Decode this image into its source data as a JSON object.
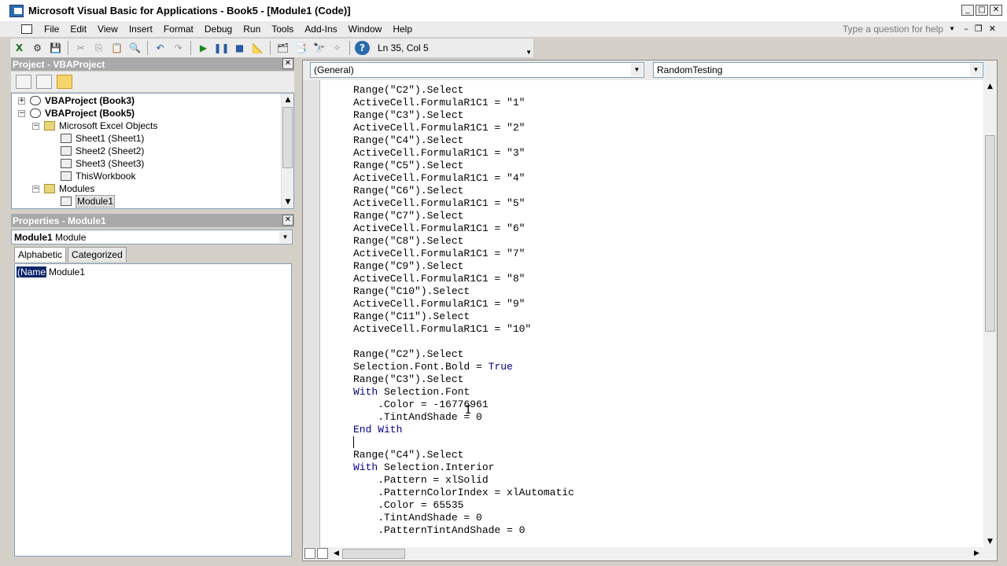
{
  "window": {
    "title": "Microsoft Visual Basic for Applications - Book5 - [Module1 (Code)]"
  },
  "menu": [
    "File",
    "Edit",
    "View",
    "Insert",
    "Format",
    "Debug",
    "Run",
    "Tools",
    "Add-Ins",
    "Window",
    "Help"
  ],
  "help_search": {
    "placeholder": "Type a question for help"
  },
  "toolbar": {
    "status": "Ln 35, Col 5"
  },
  "project_panel": {
    "title": "Project - VBAProject",
    "tree": [
      {
        "label": "VBAProject (Book3)",
        "bold": true,
        "level": 0,
        "expander": "+",
        "icon": "vbaproject-icon"
      },
      {
        "label": "VBAProject (Book5)",
        "bold": true,
        "level": 0,
        "expander": "−",
        "icon": "vbaproject-icon"
      },
      {
        "label": "Microsoft Excel Objects",
        "level": 1,
        "expander": "−",
        "icon": "folder-icon"
      },
      {
        "label": "Sheet1 (Sheet1)",
        "level": 2,
        "icon": "worksheet-icon"
      },
      {
        "label": "Sheet2 (Sheet2)",
        "level": 2,
        "icon": "worksheet-icon"
      },
      {
        "label": "Sheet3 (Sheet3)",
        "level": 2,
        "icon": "worksheet-icon"
      },
      {
        "label": "ThisWorkbook",
        "level": 2,
        "icon": "workbook-icon"
      },
      {
        "label": "Modules",
        "level": 1,
        "expander": "−",
        "icon": "folder-icon"
      },
      {
        "label": "Module1",
        "level": 2,
        "icon": "module-icon",
        "selected": true
      }
    ]
  },
  "properties_panel": {
    "title": "Properties - Module1",
    "object_name": "Module1",
    "object_type": "Module",
    "tabs": [
      "Alphabetic",
      "Categorized"
    ],
    "rows": [
      {
        "name": "(Name)",
        "value": "Module1"
      }
    ]
  },
  "code_window": {
    "object_combo": "(General)",
    "procedure_combo": "RandomTesting",
    "lines": [
      {
        "t": "Range(\"C2\").Select"
      },
      {
        "t": "ActiveCell.FormulaR1C1 = \"1\""
      },
      {
        "t": "Range(\"C3\").Select"
      },
      {
        "t": "ActiveCell.FormulaR1C1 = \"2\""
      },
      {
        "t": "Range(\"C4\").Select"
      },
      {
        "t": "ActiveCell.FormulaR1C1 = \"3\""
      },
      {
        "t": "Range(\"C5\").Select"
      },
      {
        "t": "ActiveCell.FormulaR1C1 = \"4\""
      },
      {
        "t": "Range(\"C6\").Select"
      },
      {
        "t": "ActiveCell.FormulaR1C1 = \"5\""
      },
      {
        "t": "Range(\"C7\").Select"
      },
      {
        "t": "ActiveCell.FormulaR1C1 = \"6\""
      },
      {
        "t": "Range(\"C8\").Select"
      },
      {
        "t": "ActiveCell.FormulaR1C1 = \"7\""
      },
      {
        "t": "Range(\"C9\").Select"
      },
      {
        "t": "ActiveCell.FormulaR1C1 = \"8\""
      },
      {
        "t": "Range(\"C10\").Select"
      },
      {
        "t": "ActiveCell.FormulaR1C1 = \"9\""
      },
      {
        "t": "Range(\"C11\").Select"
      },
      {
        "t": "ActiveCell.FormulaR1C1 = \"10\""
      },
      {
        "t": ""
      },
      {
        "t": "Range(\"C2\").Select"
      },
      {
        "t": "Selection.Font.Bold = ",
        "kw_suffix": "True"
      },
      {
        "t": "Range(\"C3\").Select"
      },
      {
        "kw_prefix": "With",
        "t": " Selection.Font"
      },
      {
        "t": "    .Color = -16776961"
      },
      {
        "t": "    .TintAndShade = 0"
      },
      {
        "kw_prefix": "End With",
        "t": ""
      },
      {
        "t": "",
        "caret": true
      },
      {
        "t": "Range(\"C4\").Select"
      },
      {
        "kw_prefix": "With",
        "t": " Selection.Interior"
      },
      {
        "t": "    .Pattern = xlSolid"
      },
      {
        "t": "    .PatternColorIndex = xlAutomatic"
      },
      {
        "t": "    .Color = 65535"
      },
      {
        "t": "    .TintAndShade = 0"
      },
      {
        "t": "    .PatternTintAndShade = 0"
      }
    ]
  },
  "colors": {
    "keyword": "#00008b",
    "selection": "#0a246a",
    "panel_title": "#a9a9a9"
  }
}
